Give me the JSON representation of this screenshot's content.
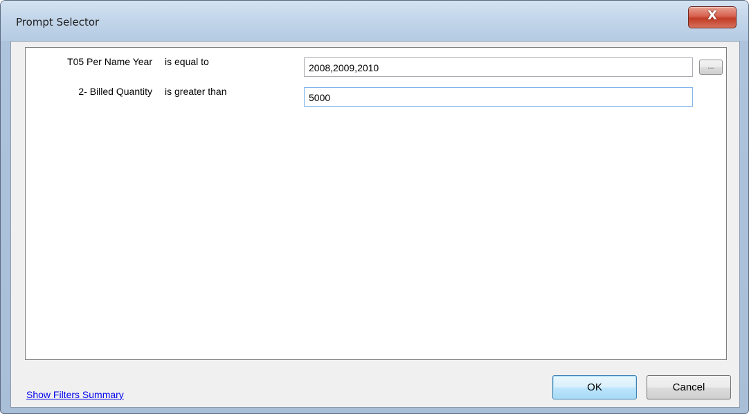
{
  "window": {
    "title": "Prompt Selector",
    "close_glyph": "X"
  },
  "filters": [
    {
      "field": "T05 Per Name Year",
      "operator": "is equal to",
      "value": "2008,2009,2010"
    },
    {
      "field": "2- Billed Quantity",
      "operator": "is greater than",
      "value": "5000"
    }
  ],
  "browse_button": {
    "label": "..."
  },
  "footer": {
    "summary_link": "Show Filters Summary",
    "ok_label": "OK",
    "cancel_label": "Cancel"
  },
  "colors": {
    "link": "#0000ee",
    "close_button": "#c13c26",
    "default_button_border": "#3c7fb1"
  }
}
